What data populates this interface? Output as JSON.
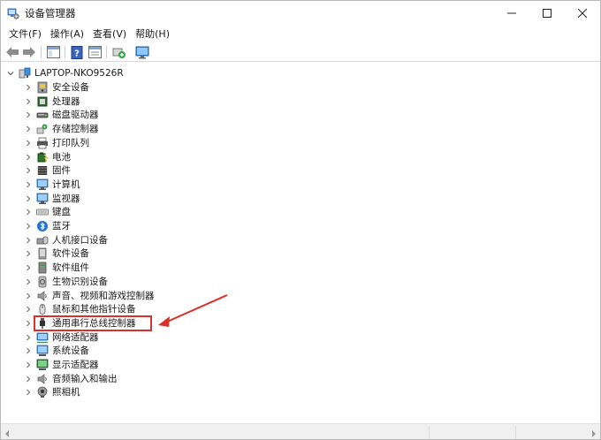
{
  "window": {
    "title": "设备管理器"
  },
  "menu": [
    "文件(F)",
    "操作(A)",
    "查看(V)",
    "帮助(H)"
  ],
  "tree": {
    "root": "LAPTOP-NKO9526R",
    "items": [
      {
        "label": "安全设备",
        "icon": "security-device-icon"
      },
      {
        "label": "处理器",
        "icon": "processor-icon"
      },
      {
        "label": "磁盘驱动器",
        "icon": "disk-drive-icon"
      },
      {
        "label": "存储控制器",
        "icon": "storage-controller-icon"
      },
      {
        "label": "打印队列",
        "icon": "printer-icon"
      },
      {
        "label": "电池",
        "icon": "battery-icon"
      },
      {
        "label": "固件",
        "icon": "firmware-icon"
      },
      {
        "label": "计算机",
        "icon": "computer-icon"
      },
      {
        "label": "监视器",
        "icon": "monitor-icon"
      },
      {
        "label": "键盘",
        "icon": "keyboard-icon"
      },
      {
        "label": "蓝牙",
        "icon": "bluetooth-icon"
      },
      {
        "label": "人机接口设备",
        "icon": "hid-icon"
      },
      {
        "label": "软件设备",
        "icon": "software-device-icon"
      },
      {
        "label": "软件组件",
        "icon": "software-component-icon"
      },
      {
        "label": "生物识别设备",
        "icon": "biometric-icon"
      },
      {
        "label": "声音、视频和游戏控制器",
        "icon": "speaker-icon"
      },
      {
        "label": "鼠标和其他指针设备",
        "icon": "mouse-icon"
      },
      {
        "label": "通用串行总线控制器",
        "icon": "usb-icon"
      },
      {
        "label": "网络适配器",
        "icon": "network-adapter-icon"
      },
      {
        "label": "系统设备",
        "icon": "system-device-icon"
      },
      {
        "label": "显示适配器",
        "icon": "display-adapter-icon"
      },
      {
        "label": "音频输入和输出",
        "icon": "audio-io-icon"
      },
      {
        "label": "照相机",
        "icon": "camera-icon"
      }
    ]
  },
  "highlight": {
    "color": "#d9302c"
  }
}
